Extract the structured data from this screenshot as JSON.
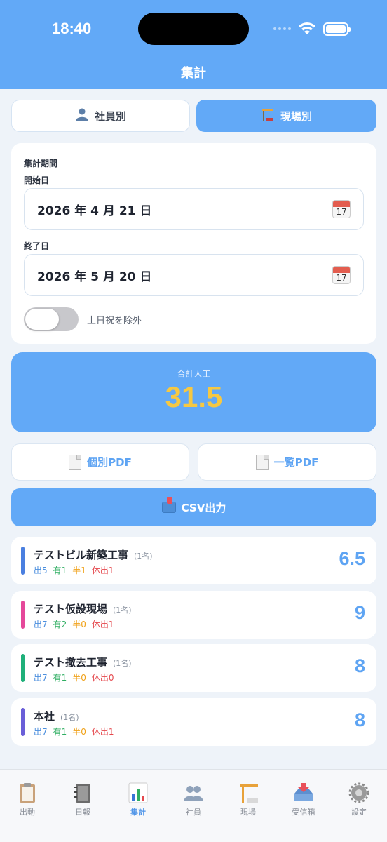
{
  "status_bar": {
    "time": "18:40"
  },
  "nav": {
    "title": "集計"
  },
  "segments": [
    {
      "label": "社員別",
      "icon": "person-icon",
      "selected": false
    },
    {
      "label": "現場別",
      "icon": "crane-icon",
      "selected": true
    }
  ],
  "period": {
    "heading": "集計期間",
    "start_label": "開始日",
    "start_value": "2026 年 4 月 21 日",
    "end_label": "終了日",
    "end_value": "2026 年 5 月 20 日",
    "calendar_day": "17",
    "exclude_holidays_label": "土日祝を除外",
    "exclude_holidays_on": false
  },
  "total": {
    "label": "合計人工",
    "value": "31.5"
  },
  "actions": {
    "individual_pdf": "個別PDF",
    "list_pdf": "一覧PDF",
    "csv": "CSV出力"
  },
  "colors": {
    "accent": "#62a9f7",
    "total_value": "#f6c842",
    "out": "#4c8fde",
    "paid": "#2fae62",
    "half": "#f0a21a",
    "holiday": "#e5484d"
  },
  "sites": [
    {
      "name": "テストビル新築工事",
      "count": "(1名)",
      "color": "#4a7fe0",
      "out": "出5",
      "paid": "有1",
      "half": "半1",
      "holiday": "休出1",
      "total": "6.5"
    },
    {
      "name": "テスト仮設現場",
      "count": "(1名)",
      "color": "#e5489a",
      "out": "出7",
      "paid": "有2",
      "half": "半0",
      "holiday": "休出1",
      "total": "9"
    },
    {
      "name": "テスト撤去工事",
      "count": "(1名)",
      "color": "#1fb07a",
      "out": "出7",
      "paid": "有1",
      "half": "半0",
      "holiday": "休出0",
      "total": "8"
    },
    {
      "name": "本社",
      "count": "(1名)",
      "color": "#6a5fd8",
      "out": "出7",
      "paid": "有1",
      "half": "半0",
      "holiday": "休出1",
      "total": "8"
    }
  ],
  "tabs": [
    {
      "label": "出動",
      "icon": "clipboard-icon",
      "active": false
    },
    {
      "label": "日報",
      "icon": "notebook-icon",
      "active": false
    },
    {
      "label": "集計",
      "icon": "bar-chart-icon",
      "active": true
    },
    {
      "label": "社員",
      "icon": "people-icon",
      "active": false
    },
    {
      "label": "現場",
      "icon": "crane-icon",
      "active": false
    },
    {
      "label": "受信箱",
      "icon": "inbox-icon",
      "active": false
    },
    {
      "label": "設定",
      "icon": "gear-icon",
      "active": false
    }
  ]
}
